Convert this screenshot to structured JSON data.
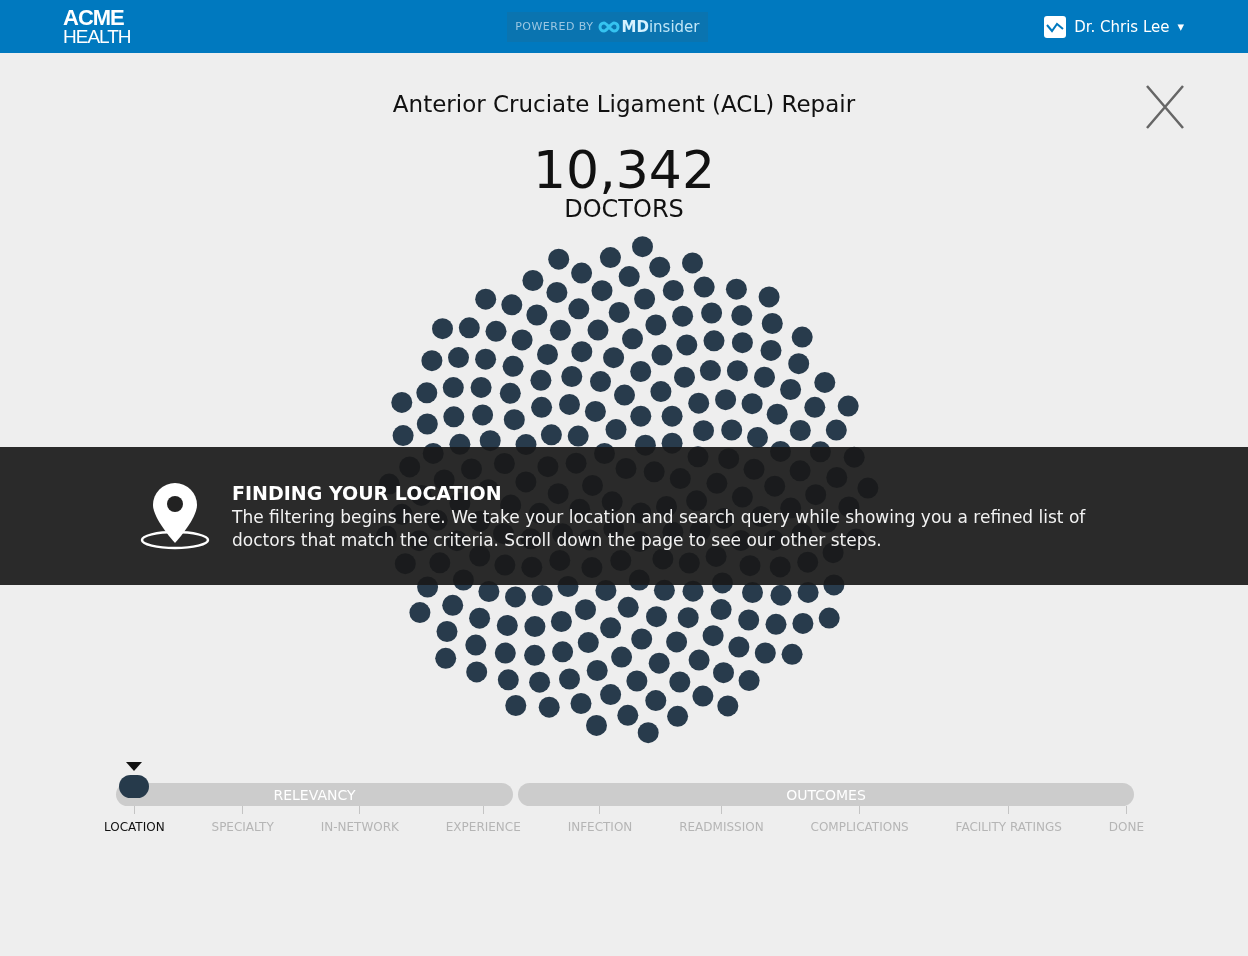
{
  "header": {
    "logo_line_1": "ACME",
    "logo_line_2": "HEALTH",
    "powered_by": "POWERED BY",
    "brand_md": "MD",
    "brand_insider": "insider",
    "user_name": "Dr. Chris Lee",
    "user_caret": "▾"
  },
  "procedure": {
    "title": "Anterior Cruciate Ligament (ACL) Repair",
    "count": "10,342",
    "count_label": "DOCTORS"
  },
  "overlay": {
    "heading": "FINDING YOUR LOCATION",
    "body": "The filtering begins here. We take your location and search query while showing you a refined list of doctors that match the criteria. Scroll down the page to see our other steps."
  },
  "progress": {
    "segments": [
      {
        "label": "RELEVANCY"
      },
      {
        "label": "OUTCOMES"
      }
    ],
    "steps": [
      {
        "label": "LOCATION",
        "selected": true
      },
      {
        "label": "SPECIALTY",
        "selected": false
      },
      {
        "label": "IN-NETWORK",
        "selected": false
      },
      {
        "label": "EXPERIENCE",
        "selected": false
      },
      {
        "label": "INFECTION",
        "selected": false
      },
      {
        "label": "READMISSION",
        "selected": false
      },
      {
        "label": "COMPLICATIONS",
        "selected": false
      },
      {
        "label": "FACILITY RATINGS",
        "selected": false
      },
      {
        "label": "DONE",
        "selected": false
      }
    ]
  }
}
